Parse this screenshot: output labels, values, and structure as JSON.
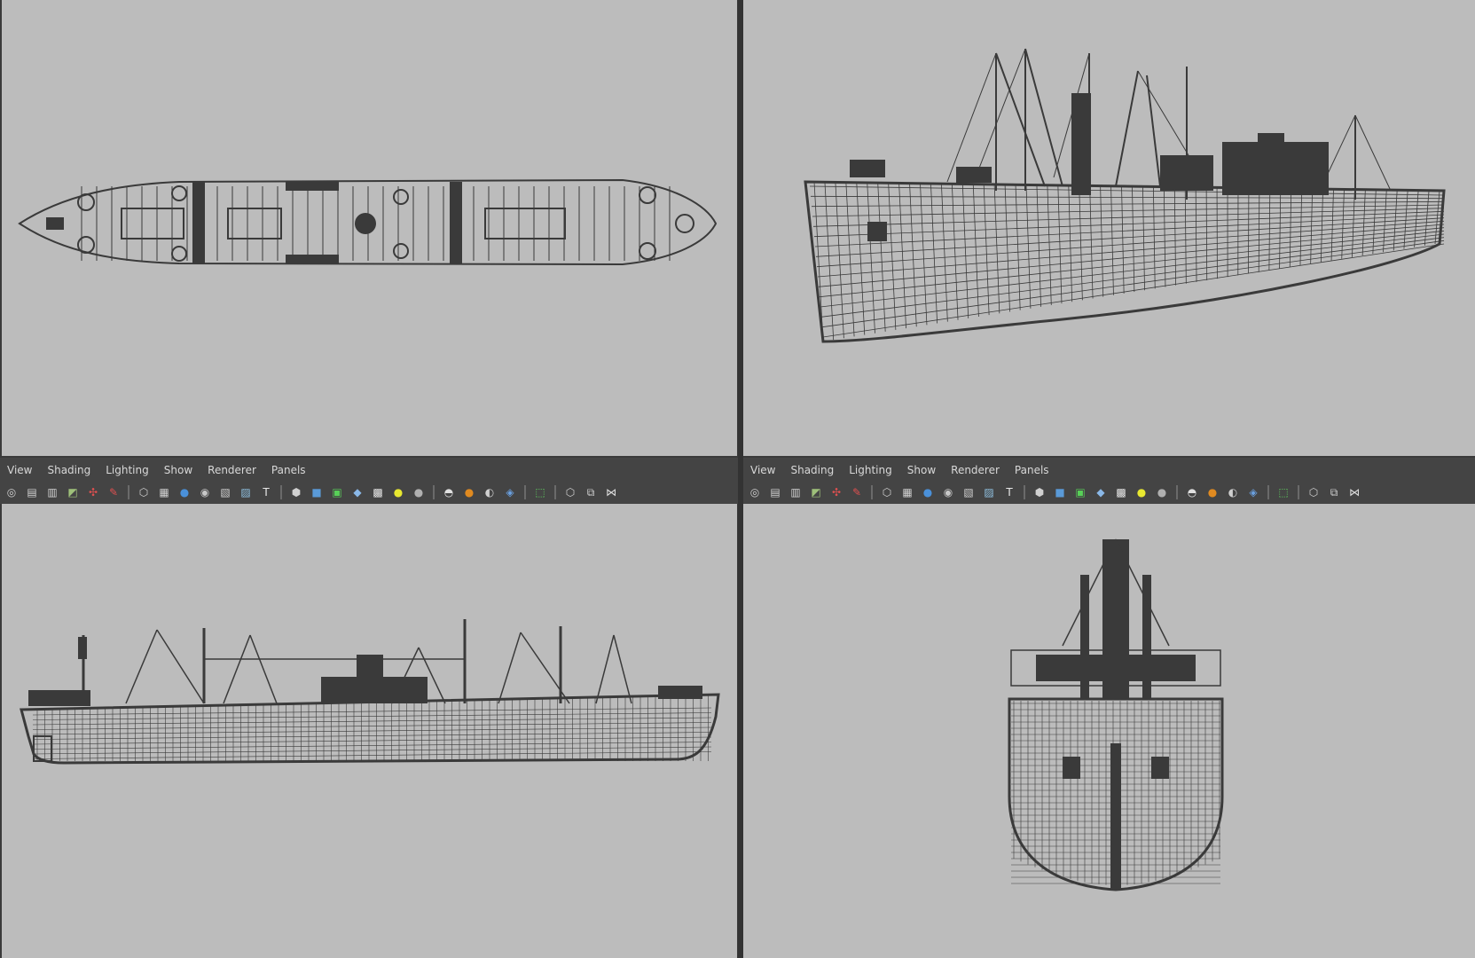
{
  "panels": {
    "left": {
      "menu": [
        "View",
        "Shading",
        "Lighting",
        "Show",
        "Renderer",
        "Panels"
      ]
    },
    "right": {
      "menu": [
        "View",
        "Shading",
        "Lighting",
        "Show",
        "Renderer",
        "Panels"
      ]
    }
  },
  "toolbar_icons": [
    {
      "name": "camera-attributes-icon",
      "glyph": "◎",
      "color": "#d0d0d0"
    },
    {
      "name": "camera-tools-icon",
      "glyph": "▤",
      "color": "#d0d0d0"
    },
    {
      "name": "bookmark-icon",
      "glyph": "▥",
      "color": "#d0d0d0"
    },
    {
      "name": "image-plane-icon",
      "glyph": "◩",
      "color": "#9ec07a"
    },
    {
      "name": "grid-icon",
      "glyph": "✣",
      "color": "#e05050"
    },
    {
      "name": "film-gate-icon",
      "glyph": "✎",
      "color": "#e05050"
    },
    {
      "sep": true
    },
    {
      "name": "wireframe-icon",
      "glyph": "⬡",
      "color": "#d0d0d0"
    },
    {
      "name": "resolution-gate-icon",
      "glyph": "▦",
      "color": "#d0d0d0"
    },
    {
      "name": "gate-mask-icon",
      "glyph": "●",
      "color": "#4a90d9"
    },
    {
      "name": "field-chart-icon",
      "glyph": "◉",
      "color": "#c8c8c8"
    },
    {
      "name": "safe-action-icon",
      "glyph": "▧",
      "color": "#d0d0d0"
    },
    {
      "name": "safe-title-icon",
      "glyph": "▨",
      "color": "#8fc0e0"
    },
    {
      "name": "text-icon",
      "glyph": "T",
      "color": "#e8e8e8"
    },
    {
      "sep": true
    },
    {
      "name": "wireframe-shading-icon",
      "glyph": "⬢",
      "color": "#d0d0d0"
    },
    {
      "name": "smooth-shade-icon",
      "glyph": "■",
      "color": "#5a9ad8"
    },
    {
      "name": "wireframe-on-shaded-icon",
      "glyph": "▣",
      "color": "#58d058"
    },
    {
      "name": "textured-icon",
      "glyph": "◆",
      "color": "#8ab8e8"
    },
    {
      "name": "checker-icon",
      "glyph": "▩",
      "color": "#e8e8e8"
    },
    {
      "name": "default-light-icon",
      "glyph": "●",
      "color": "#e8e830"
    },
    {
      "name": "all-lights-icon",
      "glyph": "●",
      "color": "#b0b0b0"
    },
    {
      "sep": true
    },
    {
      "name": "shadows-icon",
      "glyph": "◓",
      "color": "#e0e0e0"
    },
    {
      "name": "screen-space-ao-icon",
      "glyph": "●",
      "color": "#e08a20"
    },
    {
      "name": "motion-blur-icon",
      "glyph": "◐",
      "color": "#d0d0d0"
    },
    {
      "name": "multisample-icon",
      "glyph": "◈",
      "color": "#6aa0e0"
    },
    {
      "sep": true
    },
    {
      "name": "isolate-select-icon",
      "glyph": "⬚",
      "color": "#60d060"
    },
    {
      "sep": true
    },
    {
      "name": "xray-icon",
      "glyph": "⬡",
      "color": "#d0d0d0"
    },
    {
      "name": "xray-joints-icon",
      "glyph": "⧉",
      "color": "#d0d0d0"
    },
    {
      "name": "xray-components-icon",
      "glyph": "⋈",
      "color": "#e0e0e0"
    }
  ]
}
